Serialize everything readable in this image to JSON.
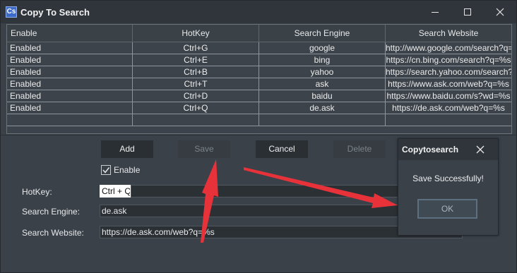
{
  "window": {
    "title": "Copy To Search",
    "icon_text": "Cs"
  },
  "table": {
    "headers": [
      "Enable",
      "HotKey",
      "Search Engine",
      "Search Website"
    ],
    "rows": [
      [
        "Enabled",
        "Ctrl+G",
        "google",
        "http://www.google.com/search?q=%s"
      ],
      [
        "Enabled",
        "Ctrl+E",
        "bing",
        "https://cn.bing.com/search?q=%s"
      ],
      [
        "Enabled",
        "Ctrl+B",
        "yahoo",
        "https://search.yahoo.com/search?p=%s"
      ],
      [
        "Enabled",
        "Ctrl+T",
        "ask",
        "https://www.ask.com/web?q=%s"
      ],
      [
        "Enabled",
        "Ctrl+D",
        "baidu",
        "https://www.baidu.com/s?wd=%s"
      ],
      [
        "Enabled",
        "Ctrl+Q",
        "de.ask",
        "https://de.ask.com/web?q=%s"
      ]
    ]
  },
  "buttons": {
    "add": "Add",
    "save": "Save",
    "cancel": "Cancel",
    "delete": "Delete"
  },
  "form": {
    "enable_label": "Enable",
    "enable_checked": true,
    "hotkey_label": "HotKey:",
    "hotkey_value": "Ctrl + Q",
    "engine_label": "Search Engine:",
    "engine_value": "de.ask",
    "website_label": "Search Website:",
    "website_value": "https://de.ask.com/web?q=%s"
  },
  "dialog": {
    "title": "Copytosearch",
    "message": "Save Successfully!",
    "ok": "OK"
  },
  "colors": {
    "annotation_arrow": "#e8323a",
    "window_bg": "#3a4149",
    "titlebar_bg": "#2f353b"
  }
}
